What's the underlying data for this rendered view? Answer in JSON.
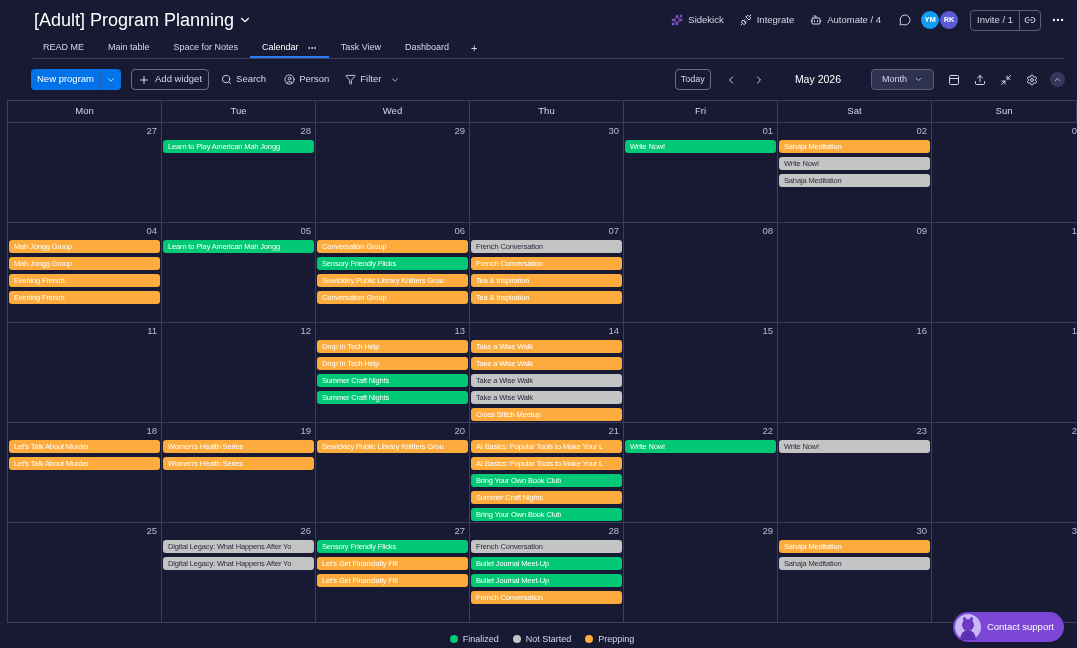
{
  "board": {
    "title": "[Adult] Program Planning"
  },
  "header_actions": [
    {
      "label": "Sidekick",
      "kind": "sidekick"
    },
    {
      "label": "Integrate",
      "kind": "integrate"
    },
    {
      "label": "Automate / 4",
      "kind": "automate"
    }
  ],
  "avatars": [
    {
      "initials": "YM",
      "color": "#0f9cf5"
    },
    {
      "initials": "RK",
      "color": "#5b5bd6"
    }
  ],
  "invite": "Invite / 1",
  "tabs": [
    {
      "label": "READ ME",
      "selected": false
    },
    {
      "label": "Main table",
      "selected": false
    },
    {
      "label": "Space for Notes",
      "selected": false
    },
    {
      "label": "Calendar",
      "selected": true
    },
    {
      "label": "Task View",
      "selected": false
    },
    {
      "label": "Dashboard",
      "selected": false
    }
  ],
  "add_tab": "+",
  "toolbar": {
    "new_button": "New program",
    "add_widget": "Add widget",
    "search": "Search",
    "person": "Person",
    "filter": "Filter"
  },
  "nav": {
    "today": "Today",
    "period": "May 2026",
    "view": "Month"
  },
  "calendar": {
    "weekdays": [
      "Mon",
      "Tue",
      "Wed",
      "Thu",
      "Fri",
      "Sat",
      "Sun"
    ],
    "weeks": [
      {
        "days": [
          {
            "date": "27"
          },
          {
            "date": "28",
            "events": [
              {
                "title": "Learn to Play American Mah Jongg",
                "color": "#00c875"
              }
            ]
          },
          {
            "date": "29"
          },
          {
            "date": "30"
          },
          {
            "date": "01",
            "events": [
              {
                "title": "Write Now!",
                "color": "#00c875"
              }
            ]
          },
          {
            "date": "02",
            "events": [
              {
                "title": "Sahaja Meditation",
                "color": "#fdab3d"
              },
              {
                "title": "Write Now!",
                "color": "#c4c4c4"
              },
              {
                "title": "Sahaja Meditation",
                "color": "#c4c4c4"
              }
            ]
          },
          {
            "date": "0"
          }
        ]
      },
      {
        "days": [
          {
            "date": "04",
            "events": [
              {
                "title": "Mah Jongg Group",
                "color": "#fdab3d"
              },
              {
                "title": "Mah Jongg Group",
                "color": "#fdab3d"
              },
              {
                "title": "Evening French",
                "color": "#fdab3d"
              },
              {
                "title": "Evening French",
                "color": "#fdab3d"
              }
            ]
          },
          {
            "date": "05",
            "events": [
              {
                "title": "Learn to Play American Mah Jongg",
                "color": "#00c875"
              }
            ]
          },
          {
            "date": "06",
            "events": [
              {
                "title": "Conversation Group",
                "color": "#fdab3d"
              },
              {
                "title": "Sensory Friendly Flicks",
                "color": "#00c875"
              },
              {
                "title": "Sewickley Public Library Knitters Grou",
                "color": "#fdab3d"
              },
              {
                "title": "Conversation Group",
                "color": "#fdab3d"
              }
            ]
          },
          {
            "date": "07",
            "events": [
              {
                "title": "French Conversation",
                "color": "#c4c4c4"
              },
              {
                "title": "French Conversation",
                "color": "#fdab3d"
              },
              {
                "title": "Tea & Inspiration",
                "color": "#fdab3d"
              },
              {
                "title": "Tea & Inspiration",
                "color": "#fdab3d"
              }
            ]
          },
          {
            "date": "08"
          },
          {
            "date": "09"
          },
          {
            "date": "1"
          }
        ]
      },
      {
        "days": [
          {
            "date": "11"
          },
          {
            "date": "12"
          },
          {
            "date": "13",
            "events": [
              {
                "title": "Drop In Tech Help",
                "color": "#fdab3d"
              },
              {
                "title": "Drop In Tech Help",
                "color": "#fdab3d"
              },
              {
                "title": "Summer Craft Nights",
                "color": "#00c875"
              },
              {
                "title": "Summer Craft Nights",
                "color": "#00c875"
              }
            ]
          },
          {
            "date": "14",
            "events": [
              {
                "title": "Take a Wise Walk",
                "color": "#fdab3d"
              },
              {
                "title": "Take a Wise Walk",
                "color": "#fdab3d"
              },
              {
                "title": "Take a Wise Walk",
                "color": "#c4c4c4"
              },
              {
                "title": "Take a Wise Walk",
                "color": "#c4c4c4"
              },
              {
                "title": "Cross Stitch Meetup",
                "color": "#fdab3d"
              }
            ]
          },
          {
            "date": "15"
          },
          {
            "date": "16"
          },
          {
            "date": "1"
          }
        ]
      },
      {
        "days": [
          {
            "date": "18",
            "events": [
              {
                "title": "Let’s Talk About Murder",
                "color": "#fdab3d"
              },
              {
                "title": "Let’s Talk About Murder",
                "color": "#fdab3d"
              }
            ]
          },
          {
            "date": "19",
            "events": [
              {
                "title": "Women’s Health Series",
                "color": "#fdab3d"
              },
              {
                "title": "Women’s Health Series",
                "color": "#fdab3d"
              }
            ]
          },
          {
            "date": "20",
            "events": [
              {
                "title": "Sewickley Public Library Knitters Grou",
                "color": "#fdab3d"
              }
            ]
          },
          {
            "date": "21",
            "events": [
              {
                "title": "AI Basics: Popular Tools to Make Your L",
                "color": "#fdab3d"
              },
              {
                "title": "AI Basics: Popular Tools to Make Your L",
                "color": "#fdab3d"
              },
              {
                "title": "Bring Your Own Book Club",
                "color": "#00c875"
              },
              {
                "title": "Summer Craft Nights",
                "color": "#fdab3d"
              },
              {
                "title": "Bring Your Own Book Club",
                "color": "#00c875"
              }
            ]
          },
          {
            "date": "22",
            "events": [
              {
                "title": "Write Now!",
                "color": "#00c875"
              }
            ]
          },
          {
            "date": "23",
            "events": [
              {
                "title": "Write Now!",
                "color": "#c4c4c4"
              }
            ]
          },
          {
            "date": "2"
          }
        ]
      },
      {
        "days": [
          {
            "date": "25"
          },
          {
            "date": "26",
            "events": [
              {
                "title": "Digital Legacy: What Happens After Yo",
                "color": "#c4c4c4"
              },
              {
                "title": "Digital Legacy: What Happens After Yo",
                "color": "#c4c4c4"
              }
            ]
          },
          {
            "date": "27",
            "events": [
              {
                "title": "Sensory Friendly Flicks",
                "color": "#00c875"
              },
              {
                "title": "Let’s Get Financially Fit!",
                "color": "#fdab3d"
              },
              {
                "title": "Let’s Get Financially Fit!",
                "color": "#fdab3d"
              }
            ]
          },
          {
            "date": "28",
            "events": [
              {
                "title": "French Conversation",
                "color": "#c4c4c4"
              },
              {
                "title": "Bullet Journal Meet-Up",
                "color": "#00c875"
              },
              {
                "title": "Bullet Journal Meet-Up",
                "color": "#00c875"
              },
              {
                "title": "French Conversation",
                "color": "#fdab3d"
              }
            ]
          },
          {
            "date": "29"
          },
          {
            "date": "30",
            "events": [
              {
                "title": "Sahaja Meditation",
                "color": "#fdab3d"
              },
              {
                "title": "Sahaja Meditation",
                "color": "#c4c4c4"
              }
            ]
          },
          {
            "date": "3"
          }
        ]
      }
    ]
  },
  "legend": [
    {
      "label": "Finalized",
      "color": "#00c875"
    },
    {
      "label": "Not Started",
      "color": "#c4c4c4"
    },
    {
      "label": "Prepping",
      "color": "#fdab3d"
    }
  ],
  "contact": "Contact support"
}
